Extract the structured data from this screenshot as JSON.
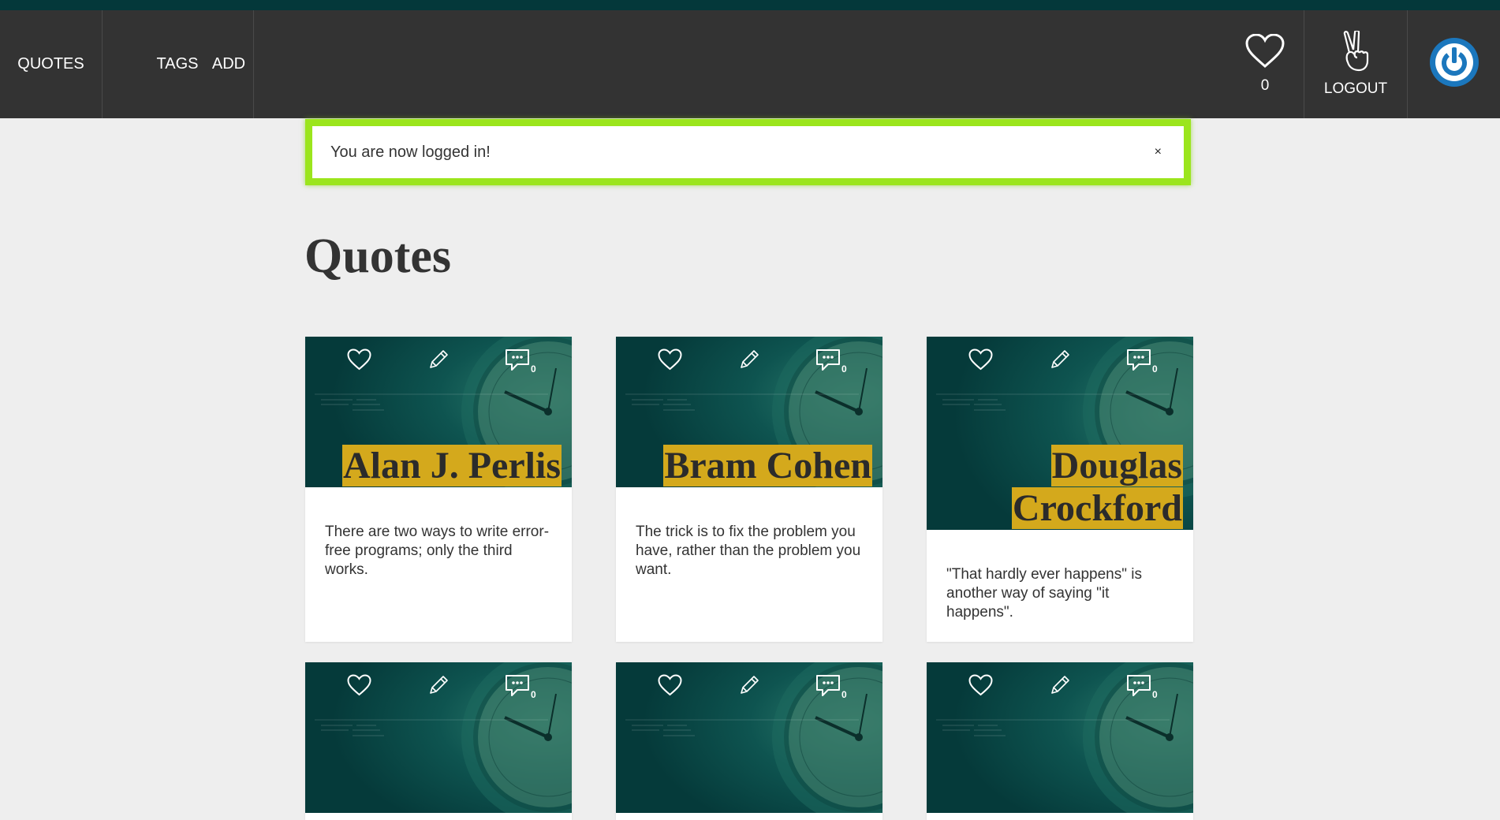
{
  "nav": {
    "items": [
      {
        "label": "QUOTES"
      },
      {
        "label": "TAGS"
      },
      {
        "label": "ADD"
      }
    ],
    "likes_count": "0",
    "logout_label": "LOGOUT"
  },
  "alert": {
    "message": "You are now logged in!",
    "close": "×"
  },
  "page": {
    "title": "Quotes"
  },
  "quotes": [
    {
      "author": "Alan J. Perlis",
      "text": "There are two ways to write error-free programs; only the third works.",
      "comments": "0"
    },
    {
      "author": "Bram Cohen",
      "text": "The trick is to fix the problem you have, rather than the problem you want.",
      "comments": "0"
    },
    {
      "author": "Douglas Crockford",
      "text": "\"That hardly ever happens\" is another way of saying \"it happens\".",
      "comments": "0"
    },
    {
      "comments": "0"
    },
    {
      "comments": "0"
    },
    {
      "comments": "0"
    }
  ],
  "colors": {
    "navbar": "#333333",
    "topstrip": "#04383a",
    "alert_border": "#9be51c",
    "author_highlight": "#d4a91c",
    "card_image": "#07403f",
    "power_icon": "#1b77bd"
  }
}
